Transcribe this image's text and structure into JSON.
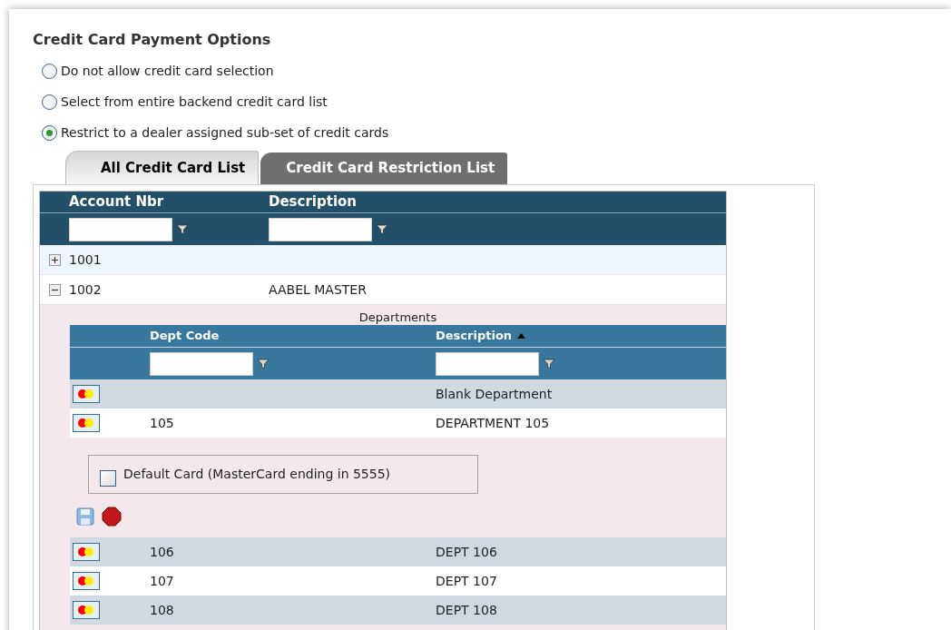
{
  "title": "Credit Card Payment Options",
  "options": [
    {
      "label": "Do not allow credit card selection",
      "selected": false
    },
    {
      "label": "Select from entire backend credit card list",
      "selected": false
    },
    {
      "label": "Restrict to a dealer assigned sub-set of credit cards",
      "selected": true
    }
  ],
  "tabs": [
    {
      "label": "All Credit Card List",
      "selected": true
    },
    {
      "label": "Credit Card Restriction List",
      "selected": false
    }
  ],
  "grid": {
    "columns": [
      "Account Nbr",
      "Description"
    ],
    "rows": [
      {
        "account": "1001",
        "expanded": false
      },
      {
        "account": "1002",
        "description": "AABEL MASTER",
        "expanded": true,
        "detail": {
          "caption": "Departments",
          "columns": [
            {
              "label": "Dept Code",
              "sorted": false
            },
            {
              "label": "Description",
              "sorted": true
            }
          ],
          "rows": [
            {
              "kind": "row",
              "description": "Blank Department"
            },
            {
              "kind": "row",
              "code": "105",
              "description": "DEPARTMENT 105"
            },
            {
              "kind": "edit",
              "checkbox": {
                "label": "Default Card (MasterCard ending in 5555)",
                "checked": false
              }
            },
            {
              "kind": "row",
              "code": "106",
              "description": "DEPT 106"
            },
            {
              "kind": "row",
              "code": "107",
              "description": "DEPT 107"
            },
            {
              "kind": "row",
              "code": "108",
              "description": "DEPT 108"
            }
          ]
        }
      }
    ]
  }
}
